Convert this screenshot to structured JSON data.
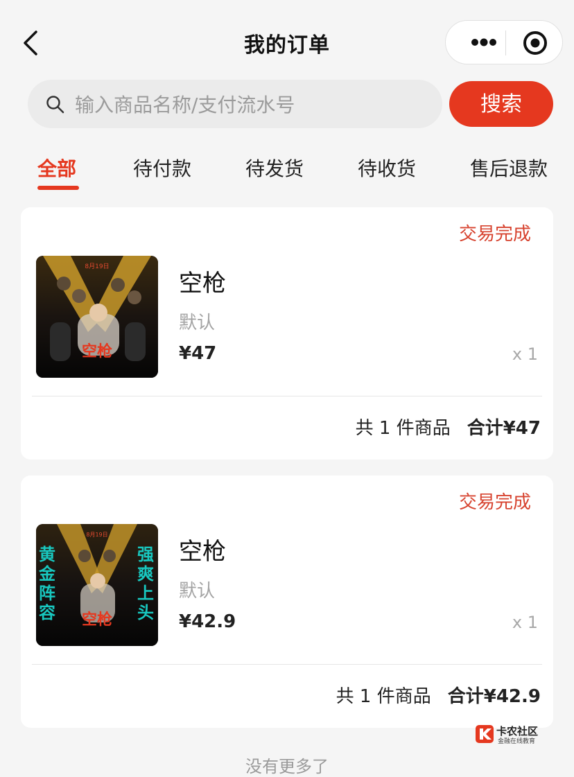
{
  "nav": {
    "title": "我的订单"
  },
  "search": {
    "placeholder": "输入商品名称/支付流水号",
    "button_label": "搜索"
  },
  "tabs": [
    {
      "label": "全部",
      "active": true
    },
    {
      "label": "待付款"
    },
    {
      "label": "待发货"
    },
    {
      "label": "待收货"
    },
    {
      "label": "售后退款"
    }
  ],
  "orders": [
    {
      "status": "交易完成",
      "product": {
        "name": "空枪",
        "spec": "默认",
        "price": "¥47",
        "qty": "x 1",
        "poster_text": "空枪"
      },
      "summary": {
        "count": "共 1 件商品",
        "total": "合计¥47"
      }
    },
    {
      "status": "交易完成",
      "product": {
        "name": "空枪",
        "spec": "默认",
        "price": "¥42.9",
        "qty": "x 1",
        "poster_text": "空枪",
        "poster_left": "黄金阵容",
        "poster_right": "强爽上头"
      },
      "summary": {
        "count": "共 1 件商品",
        "total": "合计¥42.9"
      }
    }
  ],
  "footer": {
    "no_more": "没有更多了"
  },
  "watermark": {
    "title": "卡农社区",
    "subtitle": "金融在线教育"
  },
  "colors": {
    "accent": "#e5381f",
    "status": "#d7432f",
    "poster_teal": "#18c8c0"
  }
}
